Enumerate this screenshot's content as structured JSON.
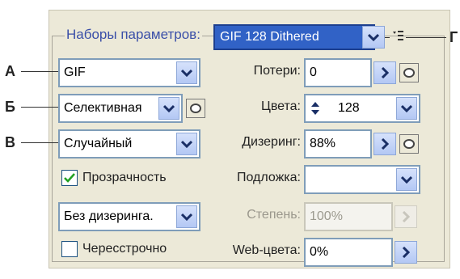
{
  "preset_group": {
    "legend": "Наборы параметров:",
    "preset_value": "GIF 128 Dithered"
  },
  "callouts": {
    "a": "А",
    "b": "Б",
    "v": "В",
    "g": "Г"
  },
  "left": {
    "format": "GIF",
    "palette": "Селективная",
    "dither_algorithm": "Случайный",
    "transparency_label": "Прозрачность",
    "transparency_checked": true,
    "transparency_dither": "Без дизеринга.",
    "interlaced_label": "Чересстрочно",
    "interlaced_checked": false
  },
  "right": {
    "lossy_label": "Потери:",
    "lossy_value": "0",
    "colors_label": "Цвета:",
    "colors_value": "128",
    "dither_label": "Дизеринг:",
    "dither_value": "88%",
    "matte_label": "Подложка:",
    "matte_value": "",
    "amount_label": "Степень:",
    "amount_value": "100%",
    "webcolors_label": "Web-цвета:",
    "webcolors_value": "0%"
  },
  "colors": {
    "accent": "#3162c6",
    "legend_text": "#3a4fa8",
    "panel_bg": "#ece9d8"
  }
}
